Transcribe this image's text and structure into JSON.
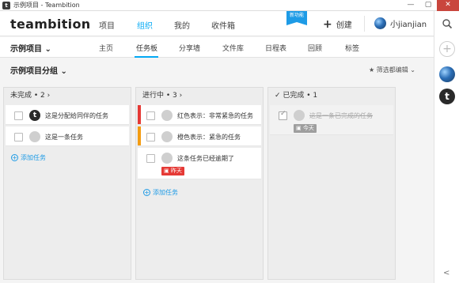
{
  "window": {
    "title": "示例项目 - Teambition",
    "app_icon": "t",
    "minimize": "—",
    "maximize": "▢",
    "close": "✕"
  },
  "topnav": {
    "logo": "teambition",
    "items": [
      "项目",
      "组织",
      "我的",
      "收件箱"
    ],
    "active_index": 1,
    "new_badge": "新功能",
    "create_label": "创建",
    "username": "小jianjian"
  },
  "subnav": {
    "project_name": "示例项目",
    "tabs": [
      "主页",
      "任务板",
      "分享墙",
      "文件库",
      "日程表",
      "回顾",
      "标签"
    ],
    "active_tab": "任务板"
  },
  "group": {
    "name": "示例项目分组",
    "filter_label": "筛选都编辑"
  },
  "rail": {
    "add": "+",
    "brand_letter": "t",
    "collapse": "<"
  },
  "columns": [
    {
      "header": "未完成 • 2",
      "tasks": [
        {
          "text": "这是分配给同伴的任务",
          "avatar": "t",
          "done": false,
          "stripe": ""
        },
        {
          "text": "这是一条任务",
          "avatar": "",
          "done": false,
          "stripe": ""
        }
      ],
      "add_label": "添加任务"
    },
    {
      "header": "进行中 • 3",
      "tasks": [
        {
          "text": "红色表示：非常紧急的任务",
          "avatar": "",
          "done": false,
          "stripe": "#e53935"
        },
        {
          "text": "橙色表示：紧急的任务",
          "avatar": "",
          "done": false,
          "stripe": "#f39c12"
        },
        {
          "text": "这条任务已经逾期了",
          "avatar": "",
          "done": false,
          "stripe": "",
          "date": "昨天",
          "date_color": "#e53935"
        }
      ],
      "add_label": "添加任务"
    },
    {
      "header": "已完成 • 1",
      "tasks": [
        {
          "text": "这是一条已完成的任务",
          "avatar": "",
          "done": true,
          "stripe": "",
          "date": "今天",
          "date_color": "#9e9e9e"
        }
      ],
      "add_label": ""
    }
  ]
}
